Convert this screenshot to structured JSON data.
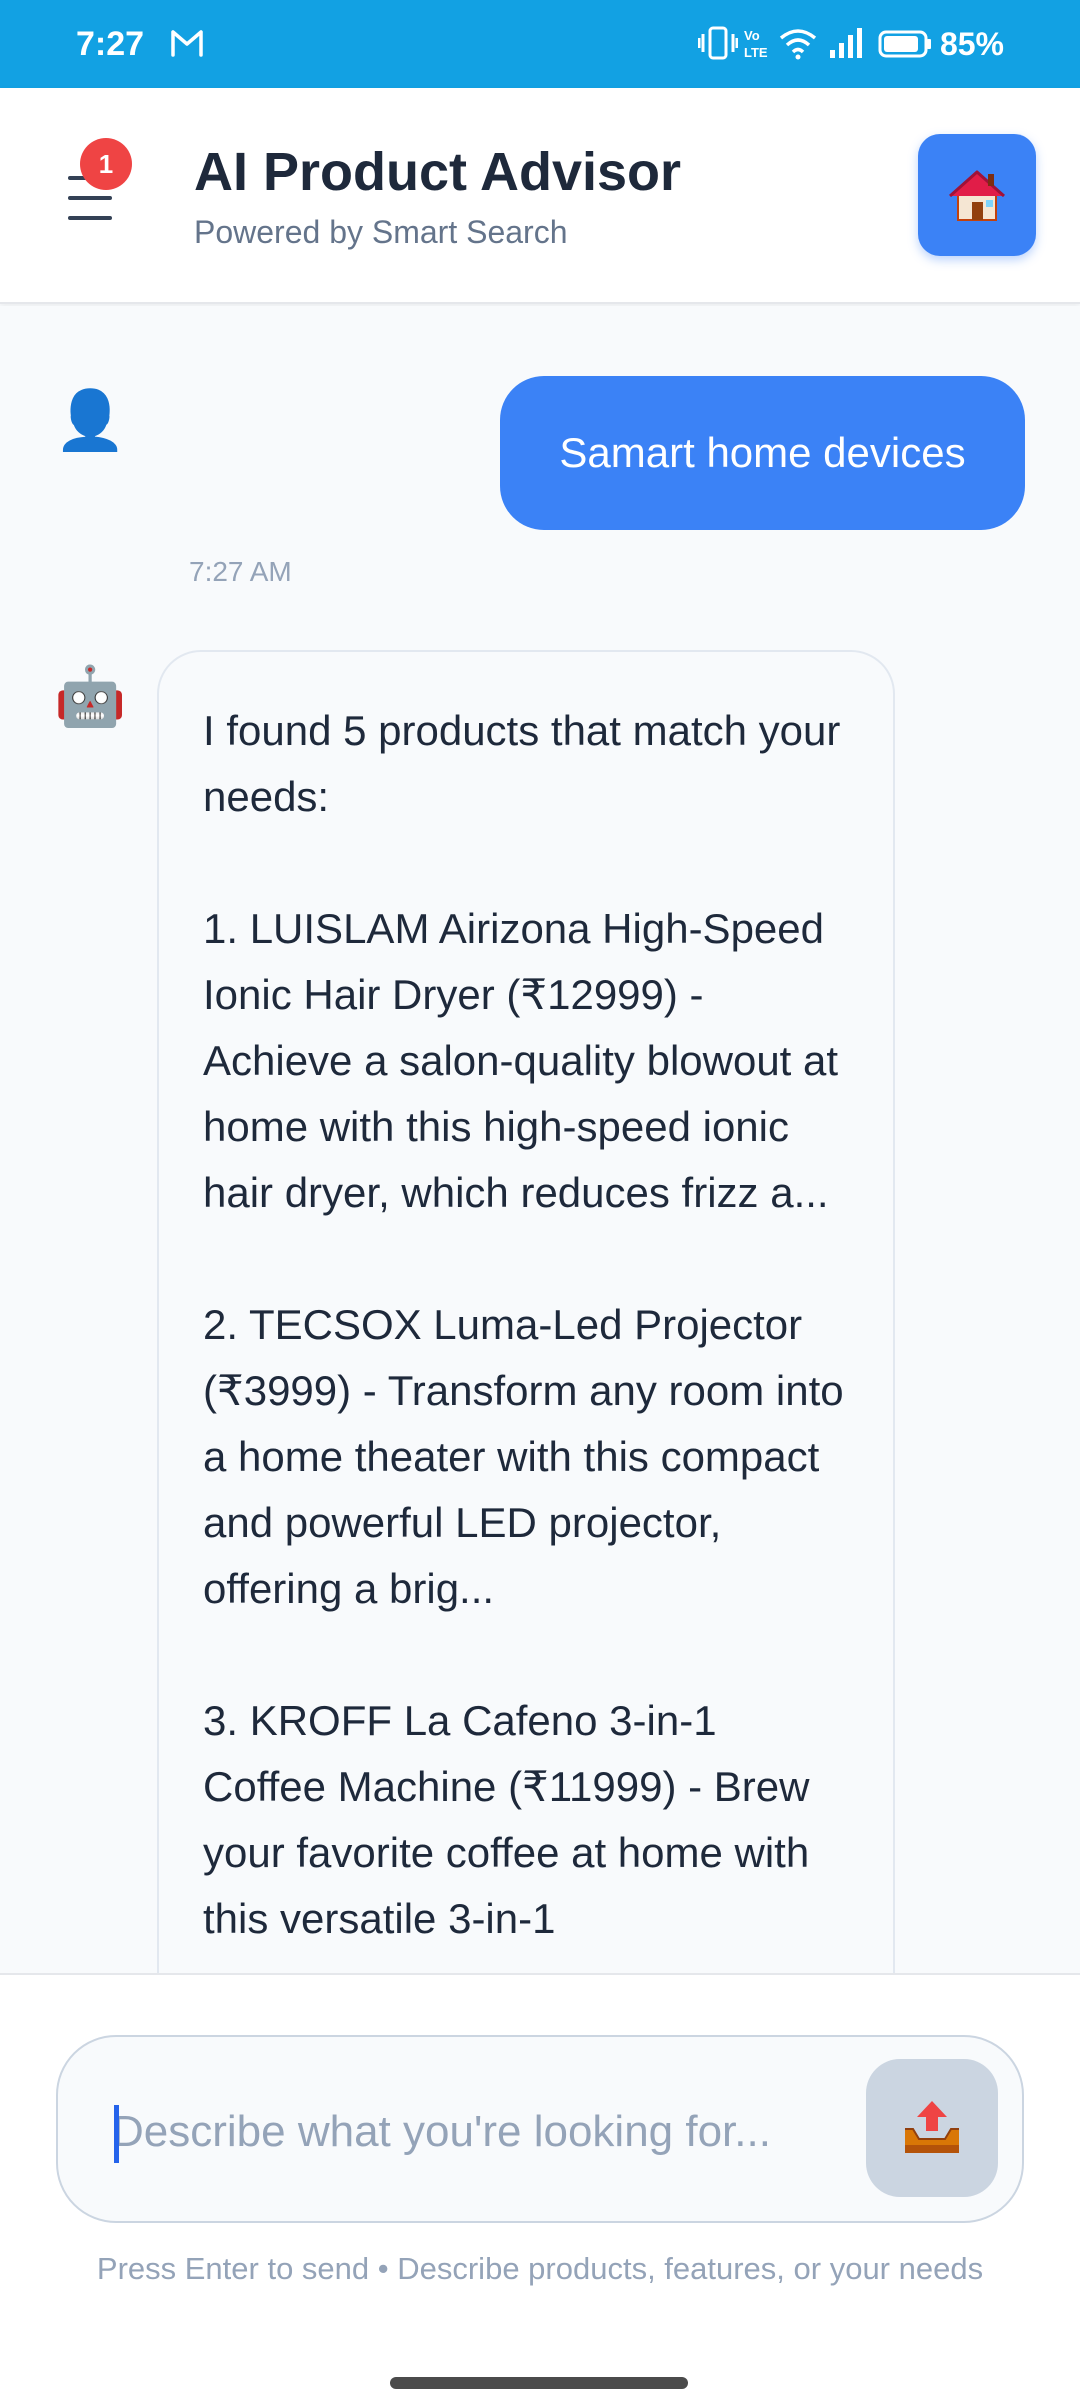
{
  "status_bar": {
    "time": "7:27",
    "battery": "85%",
    "icons": [
      "gmail-icon",
      "vibrate-icon",
      "volte-icon",
      "wifi-icon",
      "signal-icon",
      "battery-icon"
    ],
    "color": "#12a1e3"
  },
  "header": {
    "title": "AI Product Advisor",
    "subtitle": "Powered by Smart Search",
    "notification_count": "1",
    "menu_icon": "hamburger-icon",
    "home_icon": "home-icon",
    "accent": "#3b82f6"
  },
  "chat": {
    "messages": [
      {
        "sender": "user",
        "avatar": "👤",
        "text": "Samart home devices",
        "time": "7:27 AM"
      },
      {
        "sender": "bot",
        "avatar": "🤖",
        "text": "I found 5 products that match your needs:\n\n1. LUISLAM Airizona High-Speed Ionic Hair Dryer (₹12999) - Achieve a salon-quality blowout at home with this high-speed ionic hair dryer, which reduces frizz a...\n\n2. TECSOX Luma-Led Projector (₹3999) - Transform any room into a home theater with this compact and powerful LED projector, offering a brig...\n\n3. KROFF La Cafeno 3-in-1 Coffee Machine (₹11999) - Brew your favorite coffee at home with this versatile 3-in-1"
      }
    ]
  },
  "composer": {
    "placeholder": "Describe what you're looking for...",
    "value": "",
    "send_icon": "📤",
    "hint": "Press Enter to send • Describe products, features, or your needs"
  }
}
